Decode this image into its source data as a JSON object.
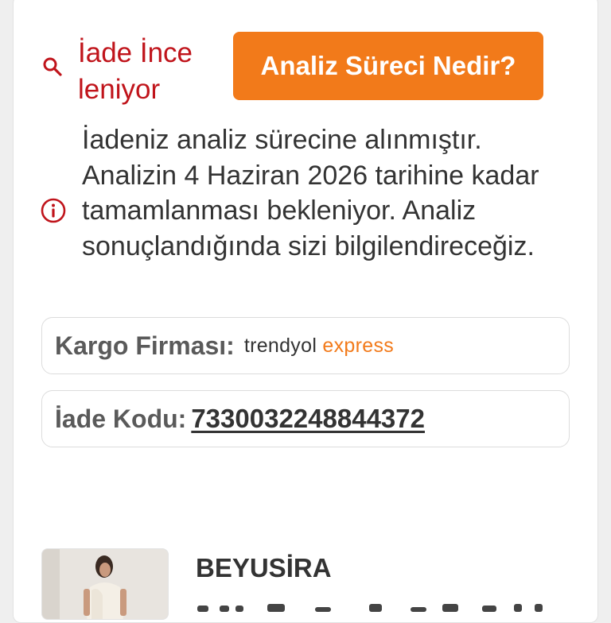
{
  "status": {
    "text": "İade İnce\nleniyor",
    "icon": "search-icon",
    "color": "#c0141b"
  },
  "analysis_button": {
    "label": "Analiz Süreci Nedir?",
    "color": "#f27a1a"
  },
  "info": {
    "icon": "info-icon",
    "message": "İadeniz analiz sürecine alınmıştır. Analizin 4 Haziran 2026 tarihine kadar tamamlanması bekleniyor. Analiz sonuçlandığında sizi bilgilendireceğiz."
  },
  "cargo": {
    "label": "Kargo Firması:",
    "brand_main": "trendyol",
    "brand_accent": "express"
  },
  "return_code": {
    "label": "İade Kodu:",
    "value": "7330032248844372"
  },
  "product": {
    "seller": "BEYUSİRA"
  }
}
